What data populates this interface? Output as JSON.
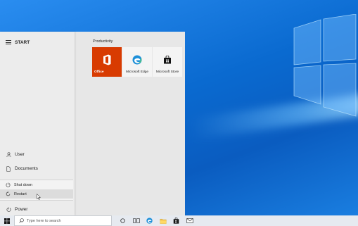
{
  "start_menu": {
    "title": "START",
    "rail": {
      "user_label": "User",
      "documents_label": "Documents",
      "power_label": "Power"
    },
    "power_menu": {
      "shutdown_label": "Shut down",
      "restart_label": "Restart"
    },
    "group": {
      "title": "Productivity",
      "tiles": [
        {
          "label": "Office",
          "icon": "office-icon",
          "color": "#d83b01"
        },
        {
          "label": "Microsoft Edge",
          "icon": "edge-icon"
        },
        {
          "label": "Microsoft Store",
          "icon": "store-icon"
        }
      ]
    }
  },
  "taskbar": {
    "search_placeholder": "Type here to search",
    "icons": [
      "cortana-icon",
      "task-view-icon",
      "edge-icon",
      "file-explorer-icon",
      "store-icon",
      "mail-icon"
    ]
  },
  "colors": {
    "accent": "#2a6fd6",
    "office": "#d83b01"
  }
}
